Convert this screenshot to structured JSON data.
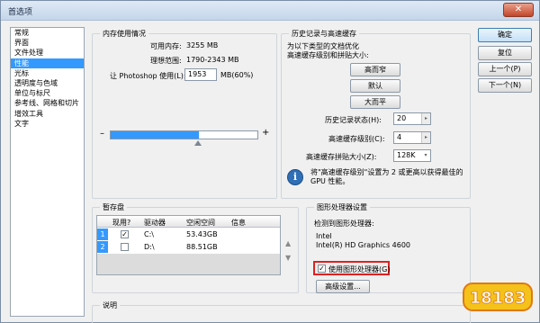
{
  "window": {
    "title": "首选项",
    "close_label": "✕"
  },
  "sidebar": {
    "items": [
      {
        "label": "常规"
      },
      {
        "label": "界面"
      },
      {
        "label": "文件处理"
      },
      {
        "label": "性能",
        "selected": true
      },
      {
        "label": "光标"
      },
      {
        "label": "透明度与色域"
      },
      {
        "label": "单位与标尺"
      },
      {
        "label": "参考线、网格和切片"
      },
      {
        "label": "增效工具"
      },
      {
        "label": "文字"
      }
    ]
  },
  "memory": {
    "title": "内存使用情况",
    "available_label": "可用内存:",
    "available_value": "3255 MB",
    "ideal_label": "理想范围:",
    "ideal_value": "1790-2343 MB",
    "let_label": "让 Photoshop 使用(L):",
    "let_value": "1953",
    "let_suffix": "MB(60%)",
    "minus": "–",
    "plus": "+",
    "slider_fraction": 0.6
  },
  "history": {
    "title": "历史记录与高速缓存",
    "desc1": "为以下类型的文档优化",
    "desc2": "高速缓存级别和拼贴大小:",
    "btn_tall": "高而窄",
    "btn_default": "默认",
    "btn_large": "大而平",
    "states_label": "历史记录状态(H):",
    "states_value": "20",
    "cache_label": "高速缓存级别(C):",
    "cache_value": "4",
    "tile_label": "高速缓存拼贴大小(Z):",
    "tile_value": "128K",
    "info1": "将\"高速缓存级别\"设置为 2 或更高以获得最佳的",
    "info2": "GPU 性能。",
    "info_icon": "i"
  },
  "scratch": {
    "title": "暂存盘",
    "headers": [
      "现用?",
      "驱动器",
      "空闲空间",
      "信息"
    ],
    "rows": [
      {
        "num": "1",
        "active": "✓",
        "drive": "C:\\",
        "free": "53.43GB",
        "info": ""
      },
      {
        "num": "2",
        "active": "",
        "drive": "D:\\",
        "free": "88.51GB",
        "info": ""
      }
    ],
    "up_arrow": "▲",
    "down_arrow": "▼"
  },
  "gpu": {
    "title": "图形处理器设置",
    "detected_label": "检测到图形处理器:",
    "vendor": "Intel",
    "model": "Intel(R) HD Graphics 4600",
    "use_gpu_label": "使用图形处理器(G)",
    "use_gpu_checked": "✓",
    "advanced_label": "高级设置..."
  },
  "description": {
    "title": "说明"
  },
  "buttons": {
    "ok": "确定",
    "reset": "复位",
    "prev": "上一个(P)",
    "next": "下一个(N)"
  },
  "colors": {
    "accent": "#3399ff",
    "highlight": "#e02020"
  }
}
